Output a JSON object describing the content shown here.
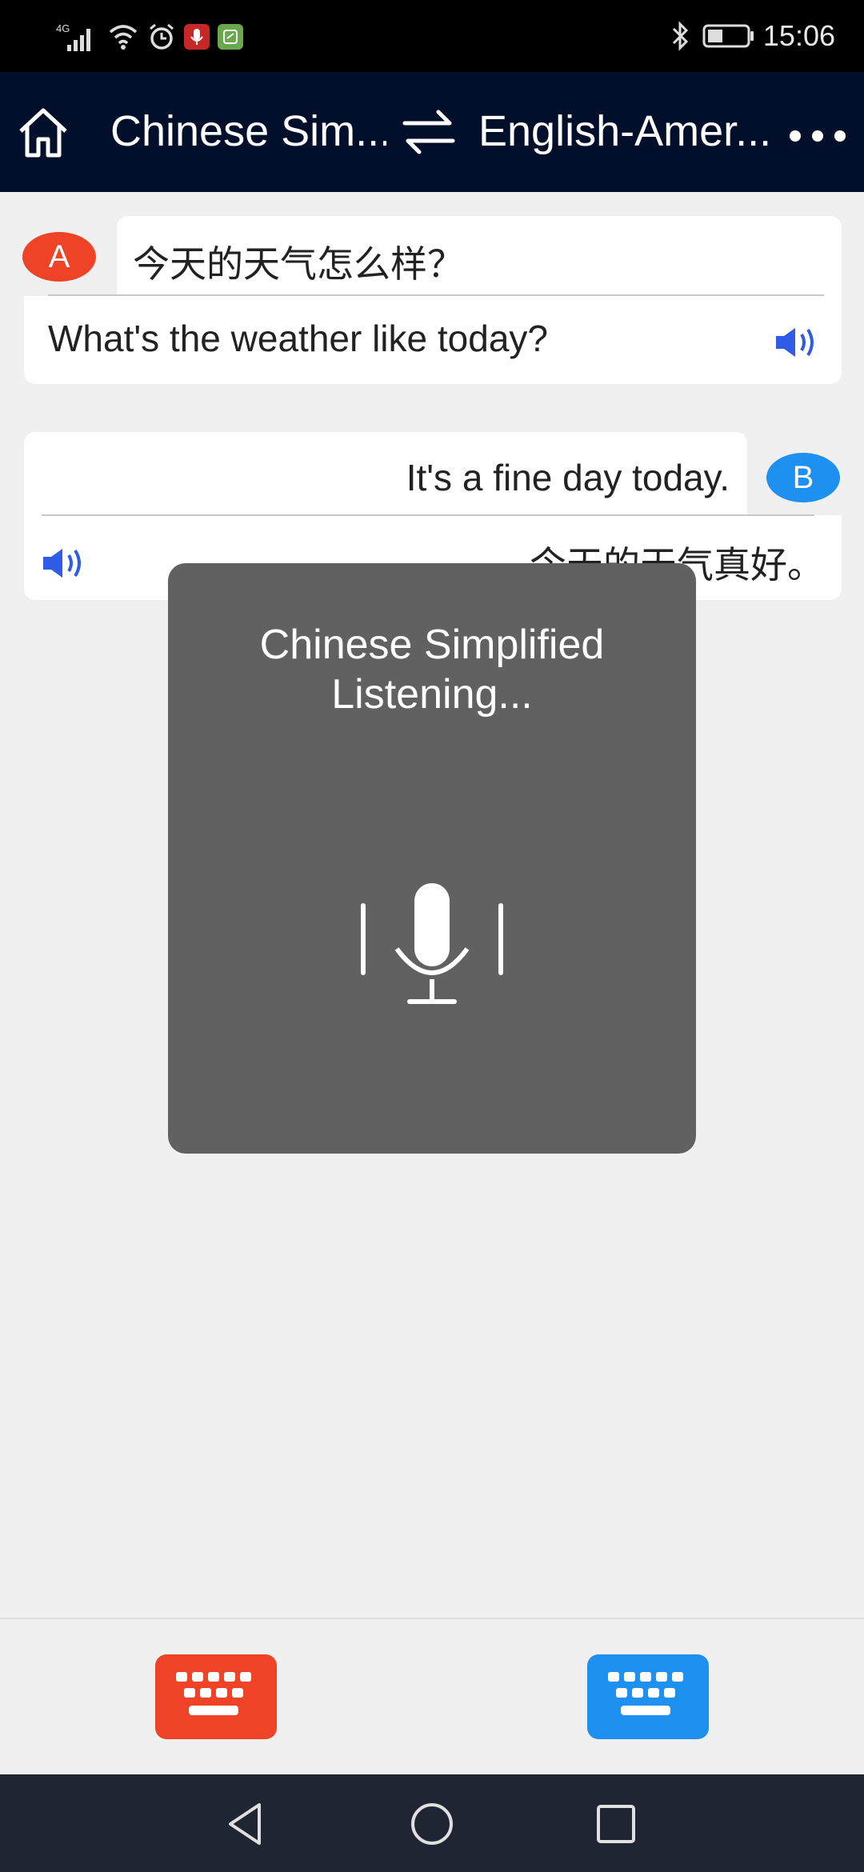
{
  "status_bar": {
    "network": "4G",
    "time": "15:06",
    "icons": [
      "signal-icon",
      "wifi-icon",
      "alarm-icon",
      "mic-notification-icon",
      "app-notification-icon",
      "bluetooth-icon",
      "battery-icon"
    ]
  },
  "app_bar": {
    "home_icon": "home-icon",
    "source_language": "Chinese Sim...",
    "swap_icon": "swap-arrows-icon",
    "target_language": "English-Amer...",
    "more_icon": "more-dots-icon"
  },
  "conversation": [
    {
      "speaker": "A",
      "source_text": "今天的天气怎么样？",
      "translation": "What's the weather like today?",
      "speaker_color": "#ee4326"
    },
    {
      "speaker": "B",
      "source_text": "It's a fine day today.",
      "translation": "今天的天气真好。",
      "speaker_color": "#1e90f0"
    }
  ],
  "listening_dialog": {
    "language": "Chinese Simplified",
    "status": "Listening...",
    "icon": "microphone-icon"
  },
  "input_bar": {
    "left_keyboard": {
      "icon": "keyboard-icon",
      "color": "#ee4326"
    },
    "right_keyboard": {
      "icon": "keyboard-icon",
      "color": "#1e90f0"
    }
  },
  "nav_bar": {
    "icons": [
      "back-icon",
      "home-circle-icon",
      "recents-icon"
    ]
  },
  "colors": {
    "app_bar": "#020f2a",
    "background": "#f0f0f0",
    "overlay": "#616161",
    "speaker_icon": "#2f5ce6"
  }
}
